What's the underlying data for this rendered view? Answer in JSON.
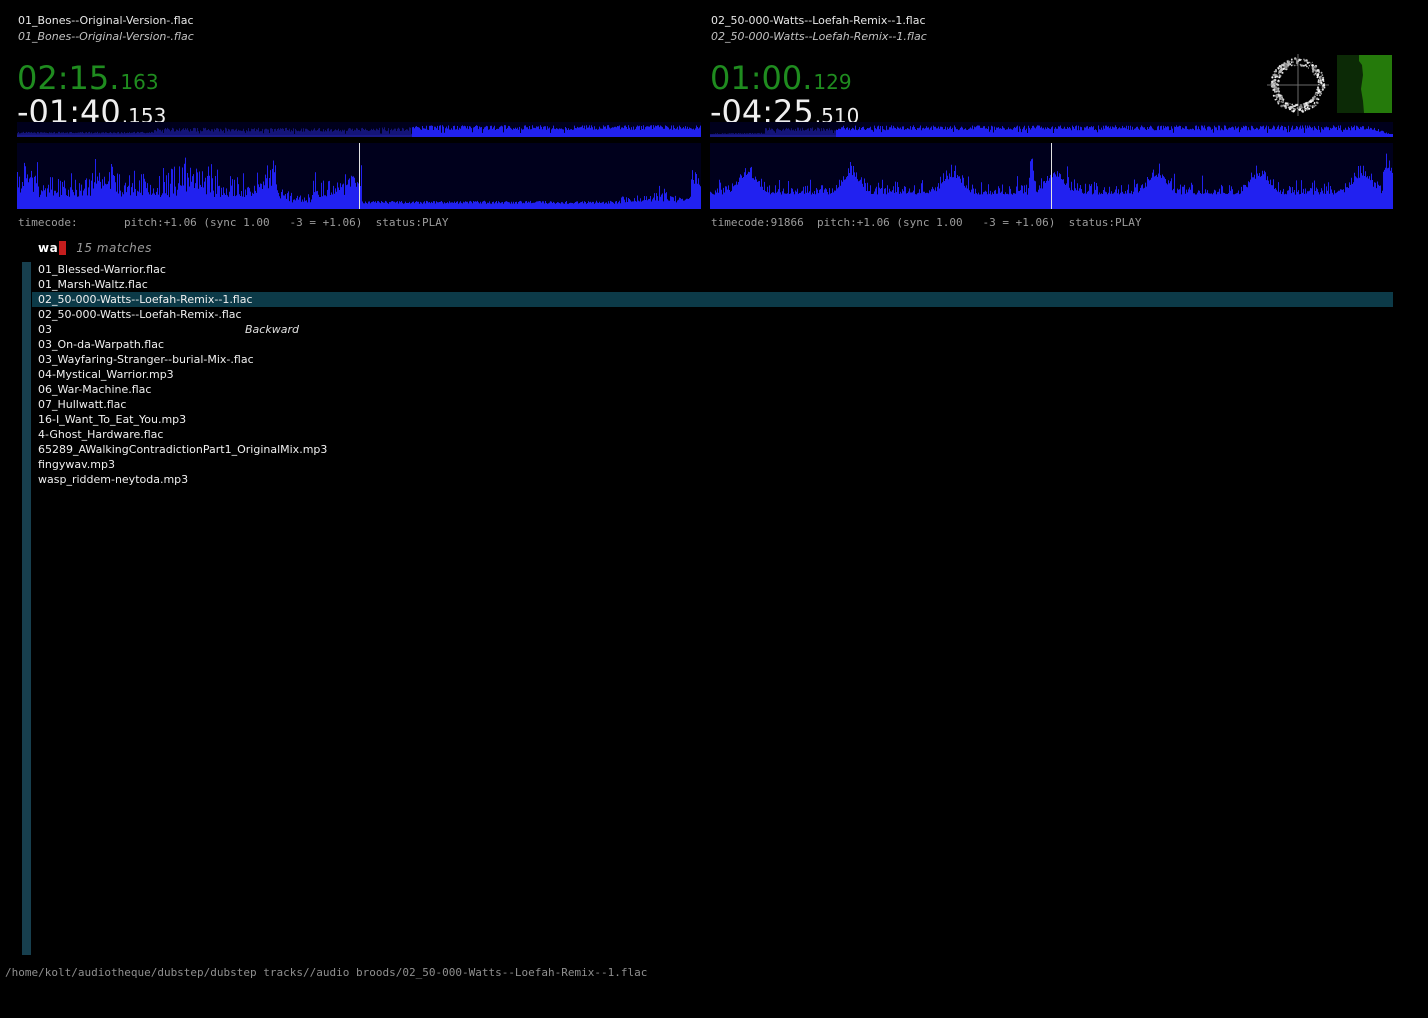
{
  "decks": [
    {
      "title": "01_Bones--Original-Version-.flac",
      "subtitle": "01_Bones--Original-Version-.flac",
      "elapsed_main": "02:15.",
      "elapsed_ms": "163",
      "remain_main": "-01:40",
      "remain_ms": ".153",
      "status_line": "timecode:       pitch:+1.06 (sync 1.00   -3 = +1.06)  status:PLAY",
      "position": 0.577
    },
    {
      "title": "02_50-000-Watts--Loefah-Remix--1.flac",
      "subtitle": "02_50-000-Watts--Loefah-Remix--1.flac",
      "elapsed_main": "01:00.",
      "elapsed_ms": "129",
      "remain_main": "-04:25",
      "remain_ms": ".510",
      "status_line": "timecode:91866  pitch:+1.06 (sync 1.00   -3 = +1.06)  status:PLAY",
      "position": 0.184
    }
  ],
  "search": {
    "query": "wa",
    "matches": "15 matches"
  },
  "tracklist": {
    "selected_index": 2,
    "items": [
      {
        "name": "01_Blessed-Warrior.flac",
        "note": ""
      },
      {
        "name": "01_Marsh-Waltz.flac",
        "note": ""
      },
      {
        "name": "02_50-000-Watts--Loefah-Remix--1.flac",
        "note": ""
      },
      {
        "name": "02_50-000-Watts--Loefah-Remix-.flac",
        "note": ""
      },
      {
        "name": "03",
        "note": "Backward"
      },
      {
        "name": "03_On-da-Warpath.flac",
        "note": ""
      },
      {
        "name": "03_Wayfaring-Stranger--burial-Mix-.flac",
        "note": ""
      },
      {
        "name": "04-Mystical_Warrior.mp3",
        "note": ""
      },
      {
        "name": "06_War-Machine.flac",
        "note": ""
      },
      {
        "name": "07_Hullwatt.flac",
        "note": ""
      },
      {
        "name": "16-I_Want_To_Eat_You.mp3",
        "note": ""
      },
      {
        "name": "4-Ghost_Hardware.flac",
        "note": ""
      },
      {
        "name": "65289_AWalkingContradictionPart1_OriginalMix.mp3",
        "note": ""
      },
      {
        "name": "fingywav.mp3",
        "note": ""
      },
      {
        "name": "wasp_riddem-neytoda.mp3",
        "note": ""
      }
    ]
  },
  "statusbar": {
    "path": "/home/kolt/audiotheque/dubstep/dubstep tracks//audio broods/02_50-000-Watts--Loefah-Remix--1.flac"
  },
  "colors": {
    "time_green": "#1f8c1f",
    "time_white": "#efefef",
    "wave_bright": "#2121f0",
    "wave_dim": "#141478",
    "wave_bg": "#00001c",
    "needle": "#e2e2e2",
    "selection_teal": "#0c3a48",
    "scrollbar_teal": "#173f4e",
    "cursor_red": "#c41d1d",
    "meter_dark_green": "#0c2a06",
    "meter_bright_green": "#257a0b"
  }
}
